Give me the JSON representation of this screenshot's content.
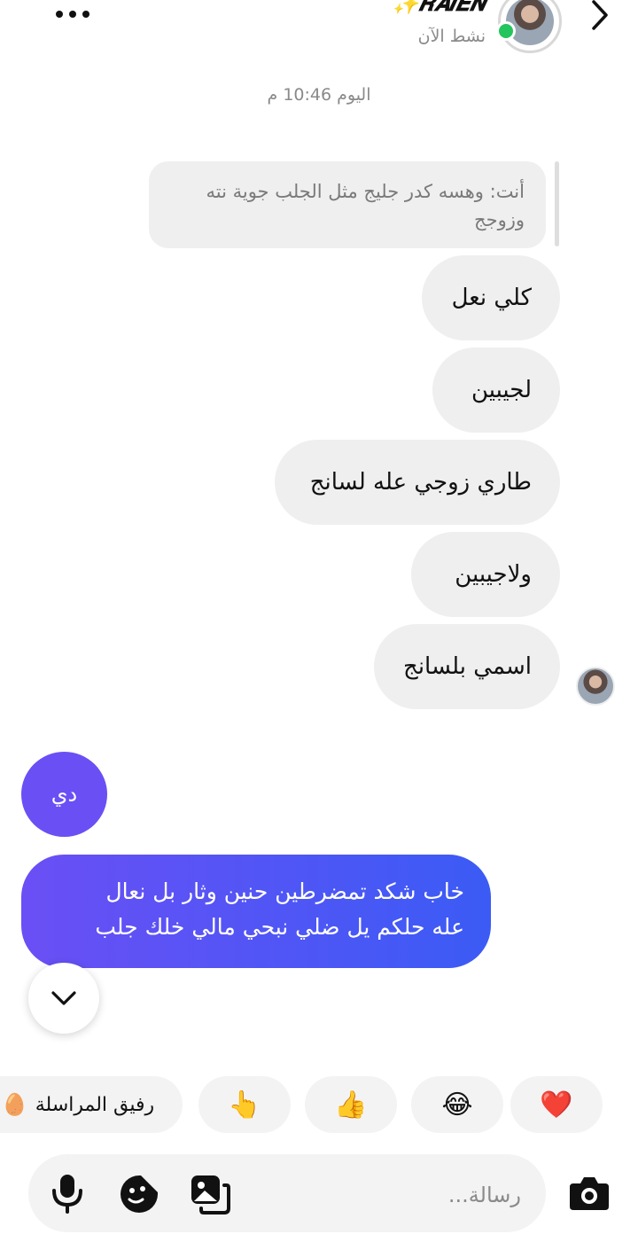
{
  "header": {
    "contact_name": "✨𝑹𝑨𝑰𝑬𝑵",
    "status": "نشط الآن",
    "icons": {
      "back": "chevron-right-icon",
      "more": "more-horizontal-icon"
    }
  },
  "timestamp": "اليوم 10:46 م",
  "reply_quote": {
    "line1": "أنت: وهسه كدر جليج مثل الجلب جوية نته",
    "line2": "وزوجج"
  },
  "incoming_messages": [
    "كلي نعل",
    "لجيبين",
    "طاري زوجي عله لسانج",
    "ولاجيبين",
    "اسمي بلسانج"
  ],
  "outgoing_messages": {
    "short": "دي",
    "long_line1": "خاب شكد تمضرطين  حنين وثار بل نعال",
    "long_line2": "عله حلكم يل ضلي نبحي  مالي خلك جلب"
  },
  "quick_reactions": [
    "❤️",
    "😂",
    "👍",
    "👆",
    "🥚"
  ],
  "ai_chip_label": "رفيق المراسلة",
  "composer": {
    "placeholder": "رسالة...",
    "value": ""
  },
  "colors": {
    "outgoing_gradient_start": "#6a4ff5",
    "outgoing_gradient_end": "#3b5bf5",
    "online": "#22c55e",
    "bubble_incoming": "#efefef"
  }
}
